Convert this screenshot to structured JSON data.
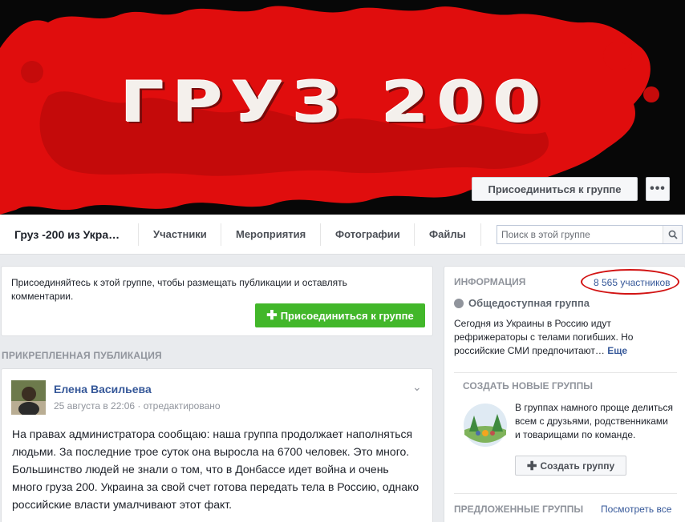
{
  "cover": {
    "title": "ГРУЗ 200",
    "join_button": "Присоединиться к группе",
    "more_button": "•••"
  },
  "navbar": {
    "group_name": "Груз -200 из Укра…",
    "tabs": [
      "Участники",
      "Мероприятия",
      "Фотографии",
      "Файлы"
    ],
    "search_placeholder": "Поиск в этой группе"
  },
  "join_card": {
    "text": "Присоединяйтесь к этой группе, чтобы размещать публикации и оставлять комментарии.",
    "button": "Присоединиться к группе"
  },
  "pinned": {
    "label": "ПРИКРЕПЛЕННАЯ ПУБЛИКАЦИЯ",
    "author": "Елена Васильева",
    "meta": "25 августа в 22:06 · отредактировано",
    "body": "На правах администратора сообщаю: наша группа продолжает наполняться людьми. За последние трое суток она выросла на 6700 человек. Это много. Большинство людей не знали о том, что в Донбассе идет война и очень много груза 200. Украина за свой счет готова передать тела в Россию, однако российские власти умалчивают этот факт."
  },
  "info": {
    "heading": "ИНФОРМАЦИЯ",
    "members": "8 565 участников",
    "privacy": "Общедоступная группа",
    "description": "Сегодня из Украины в Россию идут рефрижераторы с телами погибших. Но российские СМИ предпочитают…",
    "more": "Еще"
  },
  "create_groups": {
    "heading": "СОЗДАТЬ НОВЫЕ ГРУППЫ",
    "text": "В группах намного проще делиться всем с друзьями, родственниками и товарищами по команде.",
    "button": "Создать группу"
  },
  "suggested": {
    "heading": "ПРЕДЛОЖЕННЫЕ ГРУППЫ",
    "see_all": "Посмотреть все"
  },
  "colors": {
    "link": "#365899",
    "green": "#42b72a",
    "highlight_oval": "#d21414",
    "cover_red": "#e10e0e"
  }
}
